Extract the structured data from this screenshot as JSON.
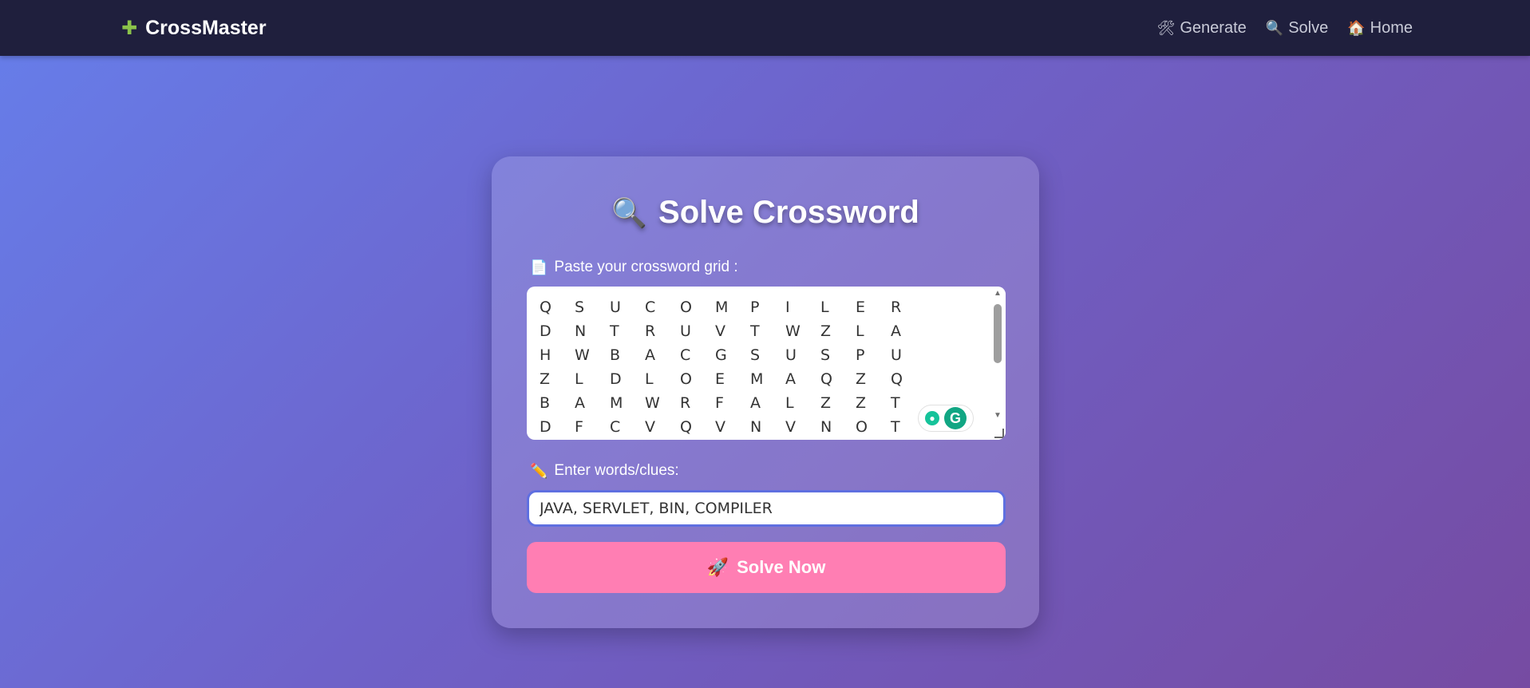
{
  "nav": {
    "brand": "CrossMaster",
    "links": [
      {
        "icon": "🛠",
        "label": "Generate"
      },
      {
        "icon": "🔍",
        "label": "Solve"
      },
      {
        "icon": "🏠",
        "label": "Home"
      }
    ]
  },
  "card": {
    "title": "Solve Crossword",
    "title_icon": "🔍",
    "grid_label_icon": "📄",
    "grid_label": "Paste your crossword grid :",
    "grid_rows": [
      [
        "Q",
        "S",
        "U",
        "C",
        "O",
        "M",
        "P",
        "I",
        "L",
        "E",
        "R"
      ],
      [
        "D",
        "N",
        "T",
        "R",
        "U",
        "V",
        "T",
        "W",
        "Z",
        "L",
        "A"
      ],
      [
        "H",
        "W",
        "B",
        "A",
        "C",
        "G",
        "S",
        "U",
        "S",
        "P",
        "U"
      ],
      [
        "Z",
        "L",
        "D",
        "L",
        "O",
        "E",
        "M",
        "A",
        "Q",
        "Z",
        "Q"
      ],
      [
        "B",
        "A",
        "M",
        "W",
        "R",
        "F",
        "A",
        "L",
        "Z",
        "Z",
        "T"
      ],
      [
        "D",
        "F",
        "C",
        "V",
        "Q",
        "V",
        "N",
        "V",
        "N",
        "O",
        "T"
      ]
    ],
    "words_label_icon": "✏️",
    "words_label": "Enter words/clues:",
    "words_value": "JAVA, SERVLET, BIN, COMPILER",
    "solve_icon": "🚀",
    "solve_label": "Solve Now"
  },
  "colors": {
    "navbar": "#1f1f3d",
    "accent_button": "#ff7eb3",
    "input_border": "#5f6fe0"
  }
}
